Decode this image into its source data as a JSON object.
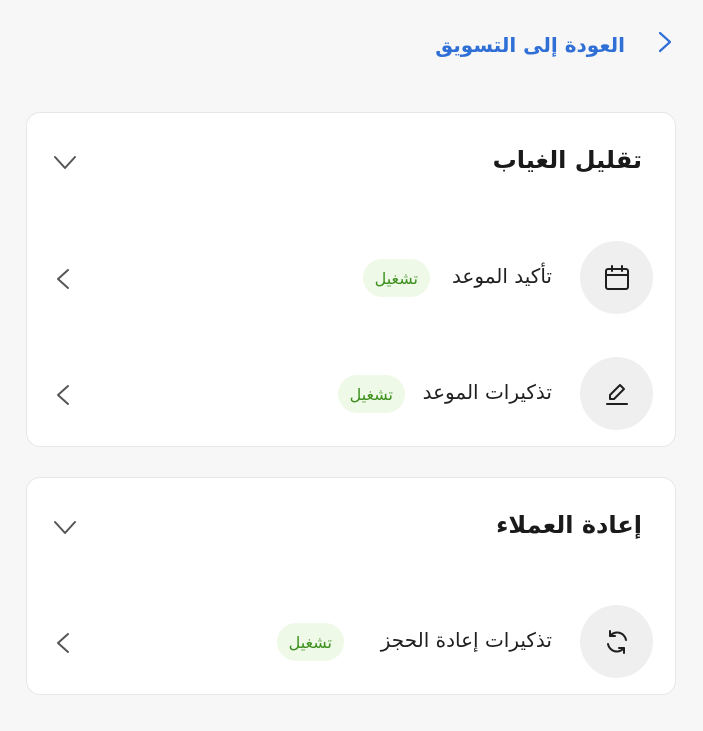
{
  "header": {
    "back_label": "العودة إلى التسويق"
  },
  "sections": [
    {
      "title": "تقليل الغياب",
      "items": [
        {
          "label": "تأكيد الموعد",
          "status": "تشغيل",
          "icon": "calendar-icon"
        },
        {
          "label": "تذكيرات الموعد",
          "status": "تشغيل",
          "icon": "pencil-icon"
        }
      ]
    },
    {
      "title": "إعادة العملاء",
      "items": [
        {
          "label": "تذكيرات إعادة الحجز",
          "status": "تشغيل",
          "icon": "refresh-icon"
        }
      ]
    }
  ],
  "colors": {
    "link": "#2f6fd6",
    "status_text": "#3c8f1c",
    "status_background": "#eef9e8",
    "page_background": "#f7f7f7",
    "card_background": "#ffffff"
  }
}
